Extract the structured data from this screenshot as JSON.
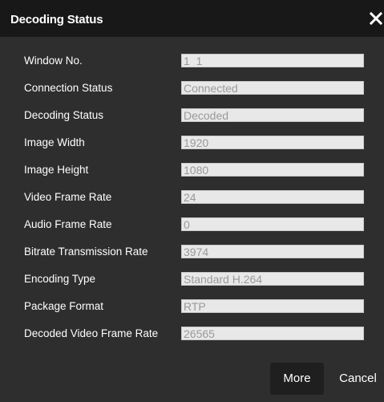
{
  "dialog": {
    "title": "Decoding Status",
    "close_icon": "close-icon"
  },
  "rows": [
    {
      "label": "Window No.",
      "value": "1_1"
    },
    {
      "label": "Connection Status",
      "value": "Connected"
    },
    {
      "label": "Decoding Status",
      "value": "Decoded"
    },
    {
      "label": "Image Width",
      "value": "1920"
    },
    {
      "label": "Image Height",
      "value": "1080"
    },
    {
      "label": "Video Frame Rate",
      "value": "24"
    },
    {
      "label": "Audio Frame Rate",
      "value": "0"
    },
    {
      "label": "Bitrate Transmission Rate",
      "value": "3974"
    },
    {
      "label": "Encoding Type",
      "value": "Standard H.264"
    },
    {
      "label": "Package Format",
      "value": "RTP"
    },
    {
      "label": "Decoded Video Frame Rate",
      "value": "26565"
    }
  ],
  "buttons": {
    "more": "More",
    "cancel": "Cancel"
  },
  "colors": {
    "dialog_bg": "#2e2e2e",
    "titlebar_bg": "#181818",
    "field_bg": "#e8e8e8",
    "field_text": "#9a9a9a",
    "label_text": "#ffffff"
  }
}
